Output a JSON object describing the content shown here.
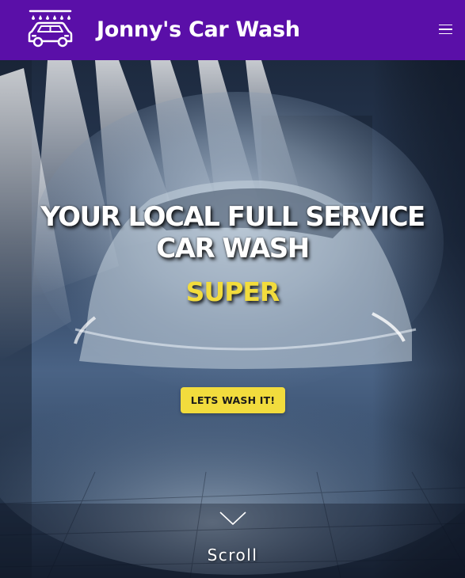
{
  "header": {
    "brand_title": "Jonny's Car Wash",
    "logo_icon": "car-wash-icon",
    "menu_icon": "hamburger-menu-icon",
    "background_color": "#5a0fa8"
  },
  "hero": {
    "heading_line_1": "YOUR LOCAL FULL SERVICE",
    "heading_line_2": "CAR WASH",
    "rotating_word": "SUPER",
    "cta_label": "LETS WASH IT!",
    "scroll_label": "Scroll",
    "scroll_icon": "chevron-down-icon",
    "background_image": "car-in-car-wash-spray-photo",
    "accent_color": "#f2dc3d"
  }
}
